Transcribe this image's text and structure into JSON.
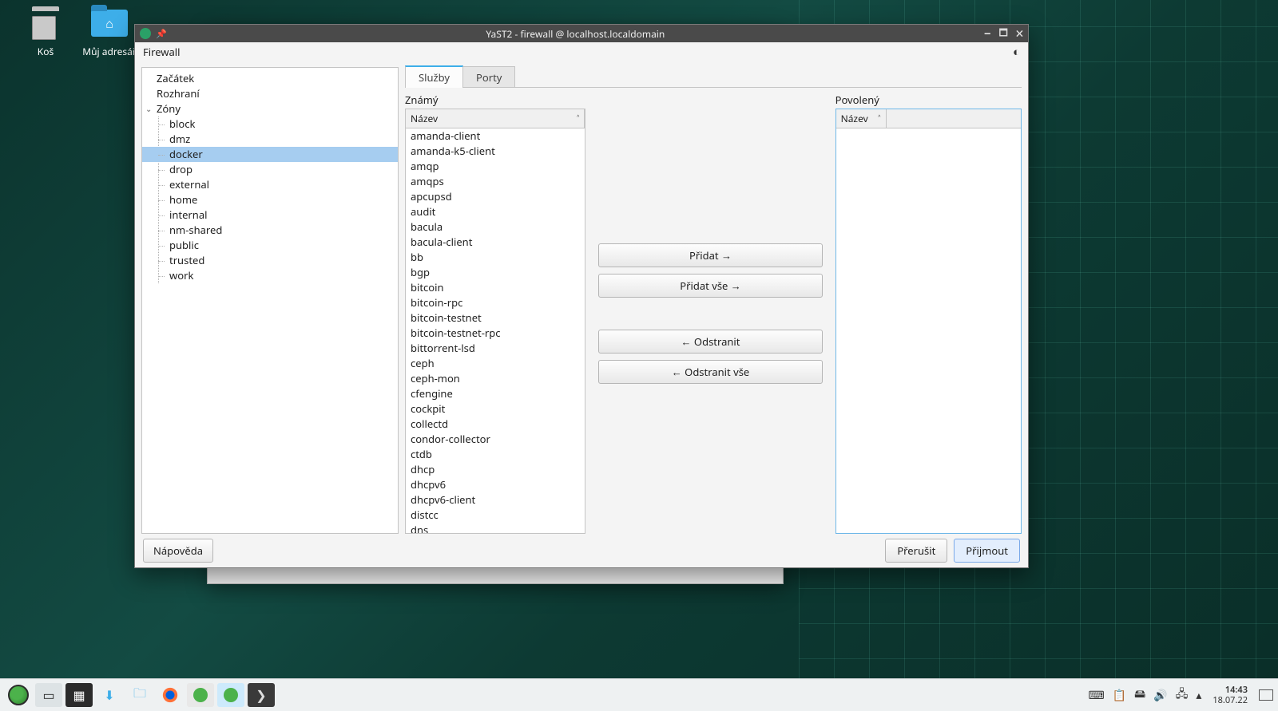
{
  "desktop": {
    "icons": [
      {
        "name": "trash-icon",
        "label": "Koš"
      },
      {
        "name": "home-folder-icon",
        "label": "Můj adresář"
      }
    ]
  },
  "window": {
    "title": "YaST2 - firewall @ localhost.localdomain",
    "module_label": "Firewall"
  },
  "tree": {
    "start": "Začátek",
    "interfaces": "Rozhraní",
    "zones_label": "Zóny",
    "zones": [
      "block",
      "dmz",
      "docker",
      "drop",
      "external",
      "home",
      "internal",
      "nm-shared",
      "public",
      "trusted",
      "work"
    ],
    "selected_zone": "docker"
  },
  "tabs": {
    "services": "Služby",
    "ports": "Porty"
  },
  "lists": {
    "known_label": "Známý",
    "allowed_label": "Povolený",
    "name_header": "Název",
    "known_services": [
      "amanda-client",
      "amanda-k5-client",
      "amqp",
      "amqps",
      "apcupsd",
      "audit",
      "bacula",
      "bacula-client",
      "bb",
      "bgp",
      "bitcoin",
      "bitcoin-rpc",
      "bitcoin-testnet",
      "bitcoin-testnet-rpc",
      "bittorrent-lsd",
      "ceph",
      "ceph-mon",
      "cfengine",
      "cockpit",
      "collectd",
      "condor-collector",
      "ctdb",
      "dhcp",
      "dhcpv6",
      "dhcpv6-client",
      "distcc",
      "dns"
    ]
  },
  "buttons": {
    "add": "Přidat →",
    "add_all": "Přidat vše →",
    "remove": "← Odstranit",
    "remove_all": "← Odstranit vše",
    "help": "Nápověda",
    "abort": "Přerušit",
    "accept": "Přijmout"
  },
  "taskbar": {
    "time": "14:43",
    "date": "18.07.22"
  }
}
